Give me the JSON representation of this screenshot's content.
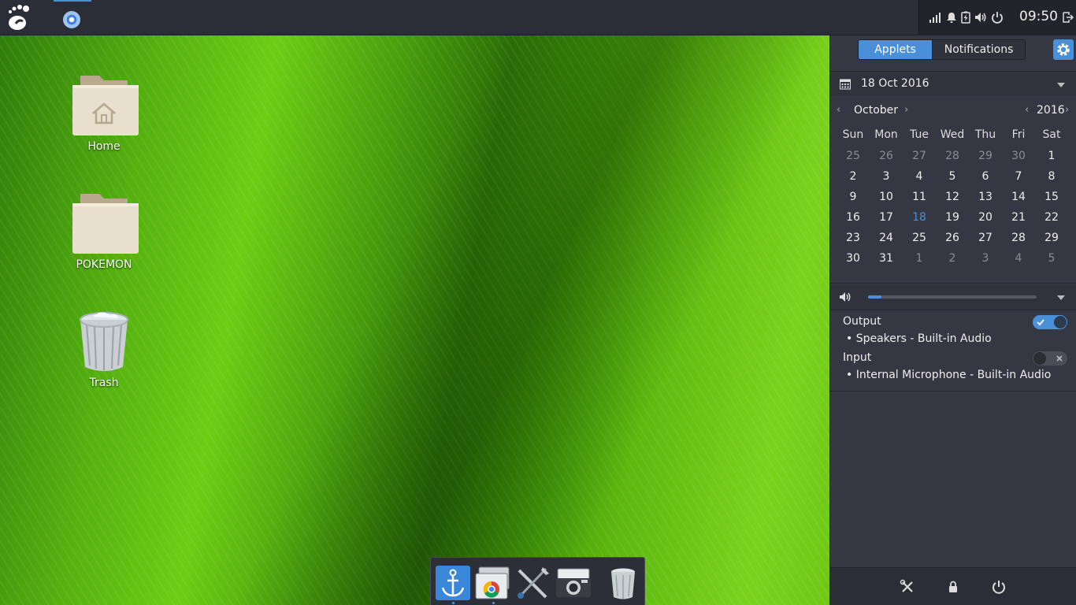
{
  "topbar": {
    "clock": "09:50"
  },
  "desktop": {
    "icons": [
      {
        "label": "Home"
      },
      {
        "label": "POKEMON"
      },
      {
        "label": "Trash"
      }
    ]
  },
  "panel": {
    "tabs": {
      "applets": "Applets",
      "notifications": "Notifications"
    },
    "date_label": "18 Oct 2016",
    "month": "October",
    "year": "2016",
    "weekdays": [
      "Sun",
      "Mon",
      "Tue",
      "Wed",
      "Thu",
      "Fri",
      "Sat"
    ],
    "weeks": [
      [
        "25",
        "26",
        "27",
        "28",
        "29",
        "30",
        "1"
      ],
      [
        "2",
        "3",
        "4",
        "5",
        "6",
        "7",
        "8"
      ],
      [
        "9",
        "10",
        "11",
        "12",
        "13",
        "14",
        "15"
      ],
      [
        "16",
        "17",
        "18",
        "19",
        "20",
        "21",
        "22"
      ],
      [
        "23",
        "24",
        "25",
        "26",
        "27",
        "28",
        "29"
      ],
      [
        "30",
        "31",
        "1",
        "2",
        "3",
        "4",
        "5"
      ]
    ],
    "today": "18",
    "volume_percent": 8,
    "audio": {
      "output_label": "Output",
      "output_device": "Speakers - Built-in Audio",
      "output_enabled": true,
      "input_label": "Input",
      "input_device": "Internal Microphone - Built-in Audio",
      "input_enabled": false
    }
  },
  "colors": {
    "accent": "#4a90d9",
    "panel_bg": "#353842",
    "topbar_bg": "#2b2e37"
  }
}
